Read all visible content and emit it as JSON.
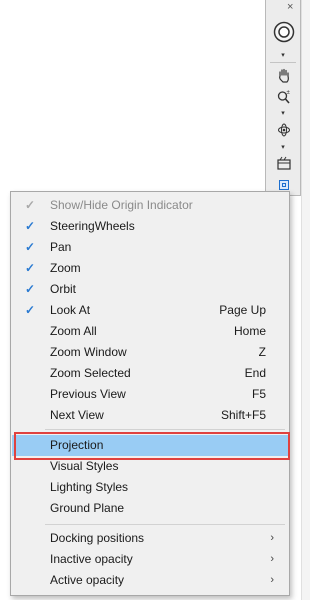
{
  "navbar": {
    "close_glyph": "×",
    "caret_glyph": "▾",
    "tools": [
      {
        "icon": "steeringwheel-icon"
      },
      {
        "icon": "pan-hand-icon"
      },
      {
        "icon": "zoom-icon"
      },
      {
        "icon": "orbit-icon"
      },
      {
        "icon": "showmotion-icon"
      },
      {
        "icon": "customize-menu-icon"
      }
    ]
  },
  "menu": {
    "items": [
      {
        "label": "Show/Hide Origin Indicator",
        "checked": true,
        "disabled": true
      },
      {
        "label": "SteeringWheels",
        "checked": true
      },
      {
        "label": "Pan",
        "checked": true
      },
      {
        "label": "Zoom",
        "checked": true
      },
      {
        "label": "Orbit",
        "checked": true
      },
      {
        "label": "Look At",
        "checked": true,
        "shortcut": "Page Up"
      },
      {
        "label": "Zoom All",
        "shortcut": "Home"
      },
      {
        "label": "Zoom Window",
        "shortcut": "Z"
      },
      {
        "label": "Zoom Selected",
        "shortcut": "End"
      },
      {
        "label": "Previous View",
        "shortcut": "F5"
      },
      {
        "label": "Next View",
        "shortcut": "Shift+F5"
      },
      {
        "label": "Projection",
        "highlighted": true
      },
      {
        "label": "Visual Styles"
      },
      {
        "label": "Lighting Styles"
      },
      {
        "label": "Ground Plane"
      },
      {
        "label": "Docking positions",
        "submenu": true
      },
      {
        "label": "Inactive opacity",
        "submenu": true
      },
      {
        "label": "Active opacity",
        "submenu": true
      }
    ],
    "check_glyph": "✓",
    "submenu_glyph": "›"
  },
  "colors": {
    "highlight": "#99ccf4",
    "annotation_box": "#e0413e",
    "check": "#2a7ad1"
  }
}
